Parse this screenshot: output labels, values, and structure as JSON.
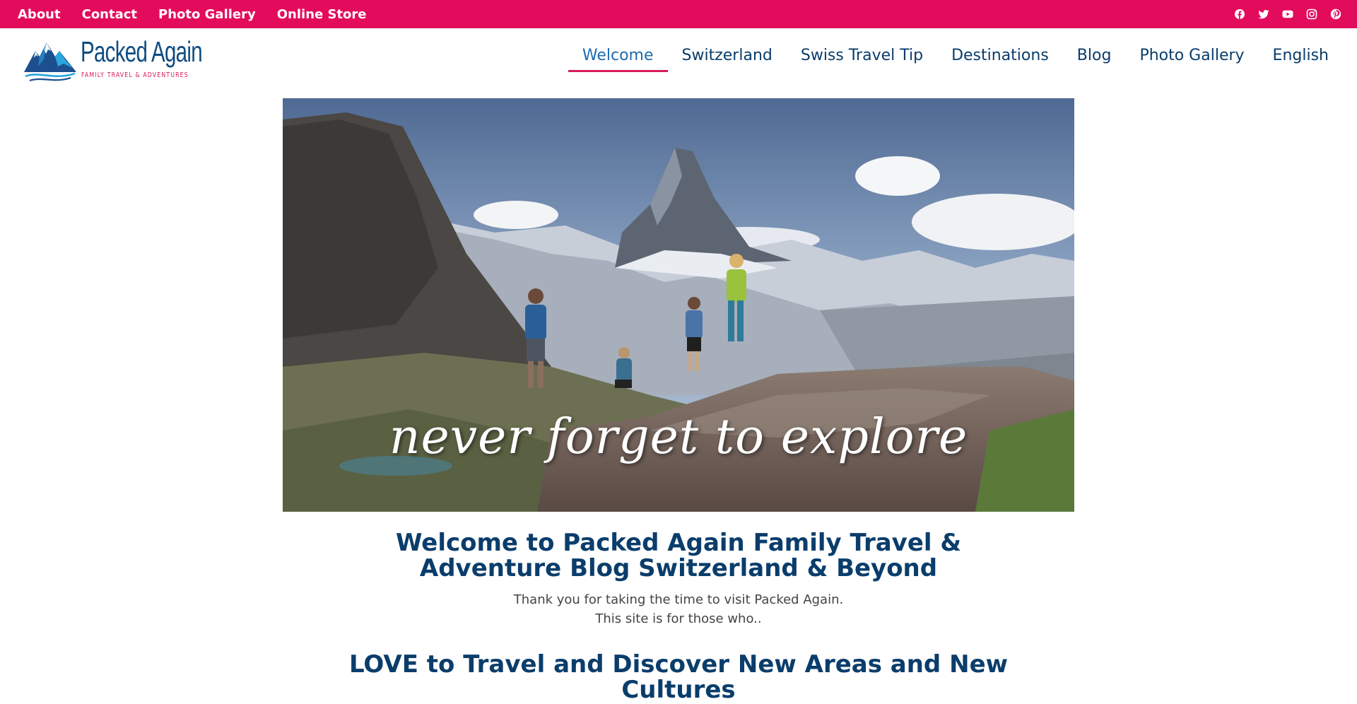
{
  "topbar": {
    "links": [
      "About",
      "Contact",
      "Photo Gallery",
      "Online Store"
    ],
    "social_icons": [
      "facebook-icon",
      "twitter-icon",
      "youtube-icon",
      "instagram-icon",
      "pinterest-icon"
    ],
    "background": "#e30b5c"
  },
  "logo": {
    "title": "Packed Again",
    "subtitle": "FAMILY TRAVEL & ADVENTURES"
  },
  "nav": {
    "items": [
      "Welcome",
      "Switzerland",
      "Swiss Travel Tip",
      "Destinations",
      "Blog",
      "Photo Gallery",
      "English"
    ],
    "active": "Welcome",
    "accent": "#d81b60"
  },
  "hero": {
    "tagline": "never forget to explore"
  },
  "content": {
    "heading": "Welcome to Packed Again Family Travel & Adventure Blog Switzerland & Beyond",
    "intro_line1": "Thank you for taking the time to visit Packed Again.",
    "intro_line2": "This site is for those who..",
    "subheading": "LOVE to Travel and Discover New Areas and New Cultures"
  }
}
